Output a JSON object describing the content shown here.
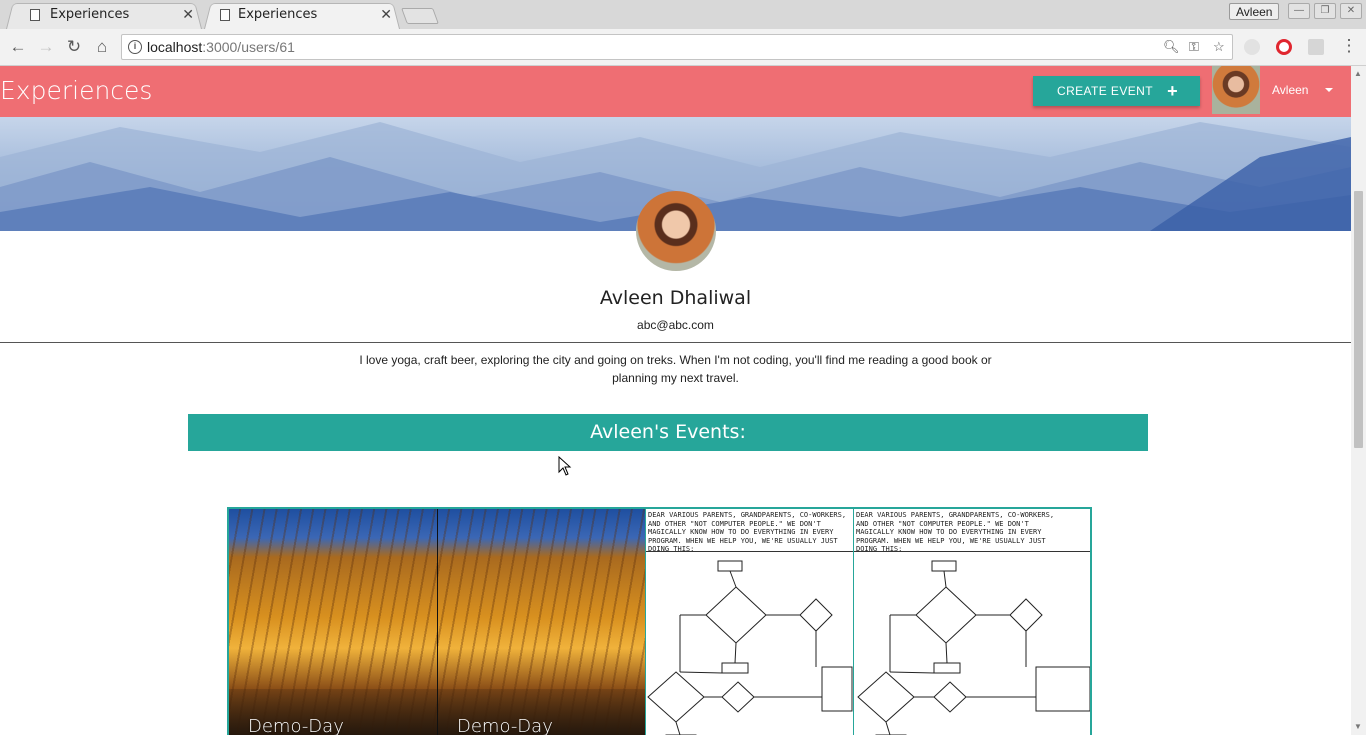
{
  "browser": {
    "tabs": [
      {
        "title": "Experiences",
        "active": false
      },
      {
        "title": "Experiences",
        "active": true
      }
    ],
    "profile_name": "Avleen",
    "url_host": "localhost",
    "url_path": ":3000/users/61"
  },
  "navbar": {
    "brand": "Experiences",
    "create_button": "CREATE EVENT",
    "create_icon": "+",
    "user_name": "Avleen"
  },
  "profile": {
    "name": "Avleen Dhaliwal",
    "email": "abc@abc.com",
    "bio": "I love yoga, craft beer, exploring the city and going on treks. When I'm not coding, you'll find me reading a good book or planning my next travel."
  },
  "events": {
    "header": "Avleen's Events:",
    "cards": [
      {
        "caption": "Demo-Day",
        "image": "train-station-photo"
      },
      {
        "caption": "Demo-Day",
        "image": "train-station-photo"
      },
      {
        "caption": "",
        "image": "flowchart-comic"
      },
      {
        "caption": "",
        "image": "flowchart-comic"
      }
    ],
    "comic_text": "Dear various parents, grandparents, co-workers, and other \"not computer people.\" We don't magically know how to do everything in every program. When we help you, we're usually just doing this:"
  },
  "colors": {
    "navbar": "#ef6e73",
    "accent": "#26a69a"
  }
}
